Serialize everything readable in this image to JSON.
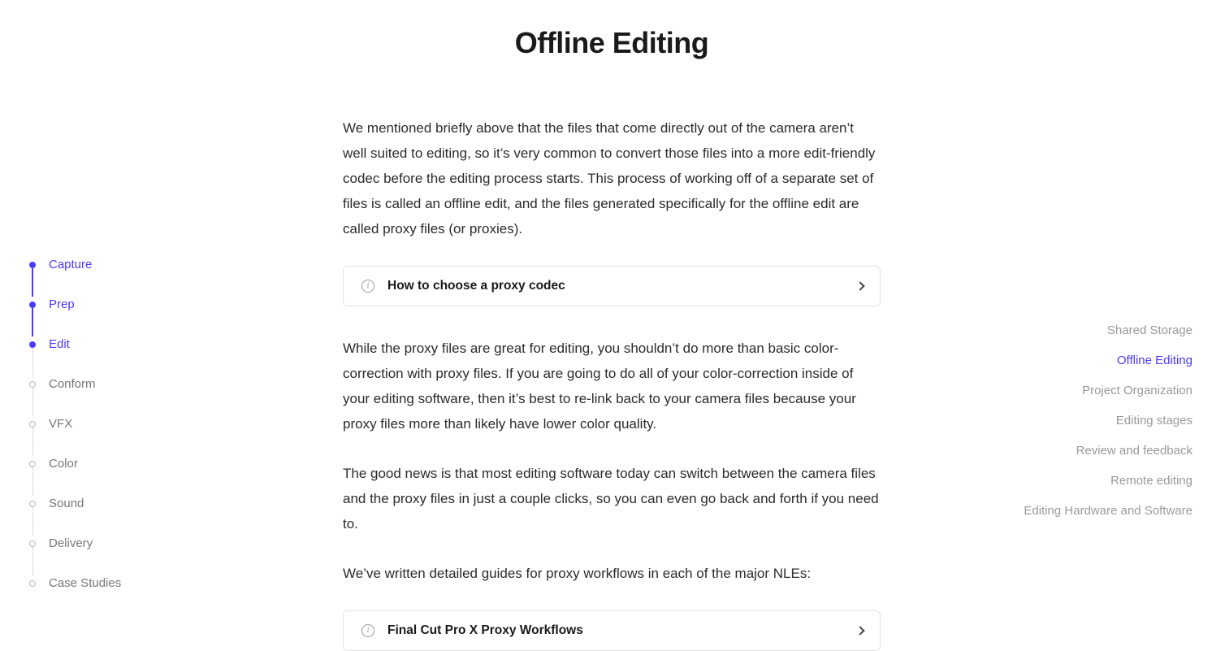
{
  "left_nav": [
    {
      "label": "Capture",
      "active": true,
      "connected": true
    },
    {
      "label": "Prep",
      "active": true,
      "connected": true
    },
    {
      "label": "Edit",
      "active": true,
      "connected": false
    },
    {
      "label": "Conform",
      "active": false,
      "connected": false
    },
    {
      "label": "VFX",
      "active": false,
      "connected": false
    },
    {
      "label": "Color",
      "active": false,
      "connected": false
    },
    {
      "label": "Sound",
      "active": false,
      "connected": false
    },
    {
      "label": "Delivery",
      "active": false,
      "connected": false
    },
    {
      "label": "Case Studies",
      "active": false,
      "connected": false
    }
  ],
  "right_nav": [
    {
      "label": "Shared Storage",
      "current": false
    },
    {
      "label": "Offline Editing",
      "current": true
    },
    {
      "label": "Project Organization",
      "current": false
    },
    {
      "label": "Editing stages",
      "current": false
    },
    {
      "label": "Review and feedback",
      "current": false
    },
    {
      "label": "Remote editing",
      "current": false
    },
    {
      "label": "Editing Hardware and Software",
      "current": false
    }
  ],
  "title": "Offline Editing",
  "para1": "We mentioned briefly above that the files that come directly out of the camera aren’t well suited to editing, so it’s very common to convert those files into a more edit-friendly codec before the editing process starts. This process of working off of a separate set of files is called an offline edit, and the files generated specifically for the offline edit are called proxy files (or proxies).",
  "card1": "How to choose a proxy codec",
  "para2": "While the proxy files are great for editing, you shouldn’t do more than basic color-correction with proxy files. If you are going to do all of your color-correction inside of your editing software, then it’s best to re-link back to your camera files because your proxy files more than likely have lower color quality.",
  "para3": "The good news is that most editing software today can switch between the camera files and the proxy files in just a couple clicks, so you can even go back and forth if you need to.",
  "para4": "We’ve written detailed guides for proxy workflows in each of the major NLEs:",
  "card2": "Final Cut Pro X Proxy Workflows"
}
